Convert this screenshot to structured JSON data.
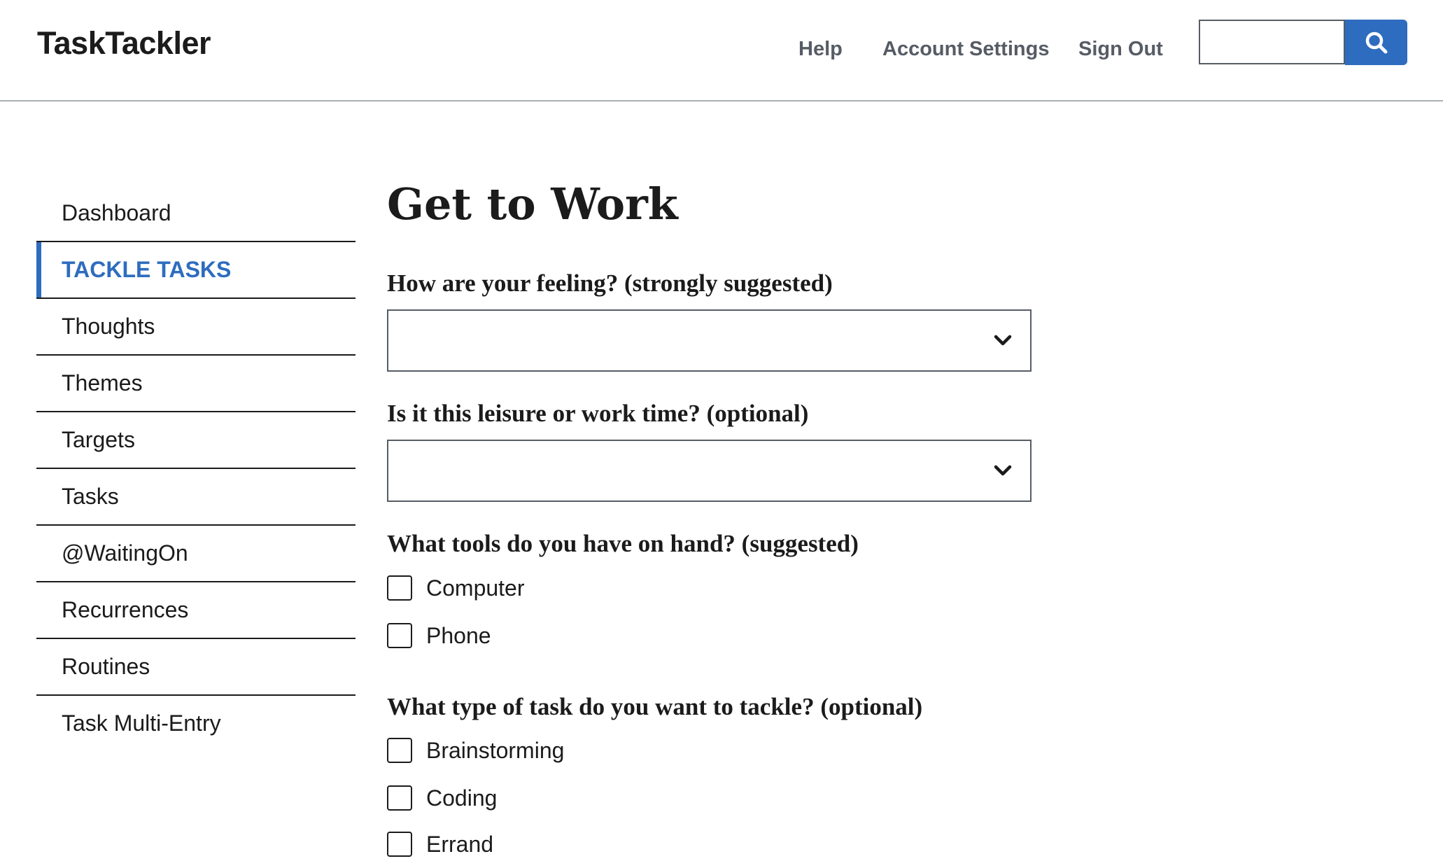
{
  "header": {
    "brand": "TaskTackler",
    "nav": [
      "Help",
      "Account Settings",
      "Sign Out"
    ],
    "search": {
      "value": "",
      "placeholder": "",
      "icon": "search-icon"
    },
    "accent": "#2e6cbf"
  },
  "sidebar": {
    "items": [
      {
        "label": "Dashboard",
        "active": false
      },
      {
        "label": "TACKLE TASKS",
        "active": true
      },
      {
        "label": "Thoughts",
        "active": false
      },
      {
        "label": "Themes",
        "active": false
      },
      {
        "label": "Targets",
        "active": false
      },
      {
        "label": "Tasks",
        "active": false
      },
      {
        "label": "@WaitingOn",
        "active": false
      },
      {
        "label": "Recurrences",
        "active": false
      },
      {
        "label": "Routines",
        "active": false
      },
      {
        "label": "Task Multi-Entry",
        "active": false
      }
    ]
  },
  "main": {
    "title": "Get to Work",
    "feeling": {
      "label": "How are your feeling? (strongly suggested)",
      "selected": ""
    },
    "time": {
      "label": "Is it this leisure or work time? (optional)",
      "selected": ""
    },
    "tools": {
      "label": "What tools do you have on hand? (suggested)",
      "options": [
        {
          "label": "Computer",
          "checked": false
        },
        {
          "label": "Phone",
          "checked": false
        }
      ]
    },
    "task_type": {
      "label": "What type of task do you want to tackle? (optional)",
      "options": [
        {
          "label": "Brainstorming",
          "checked": false
        },
        {
          "label": "Coding",
          "checked": false
        },
        {
          "label": "Errand",
          "checked": false
        }
      ]
    }
  }
}
